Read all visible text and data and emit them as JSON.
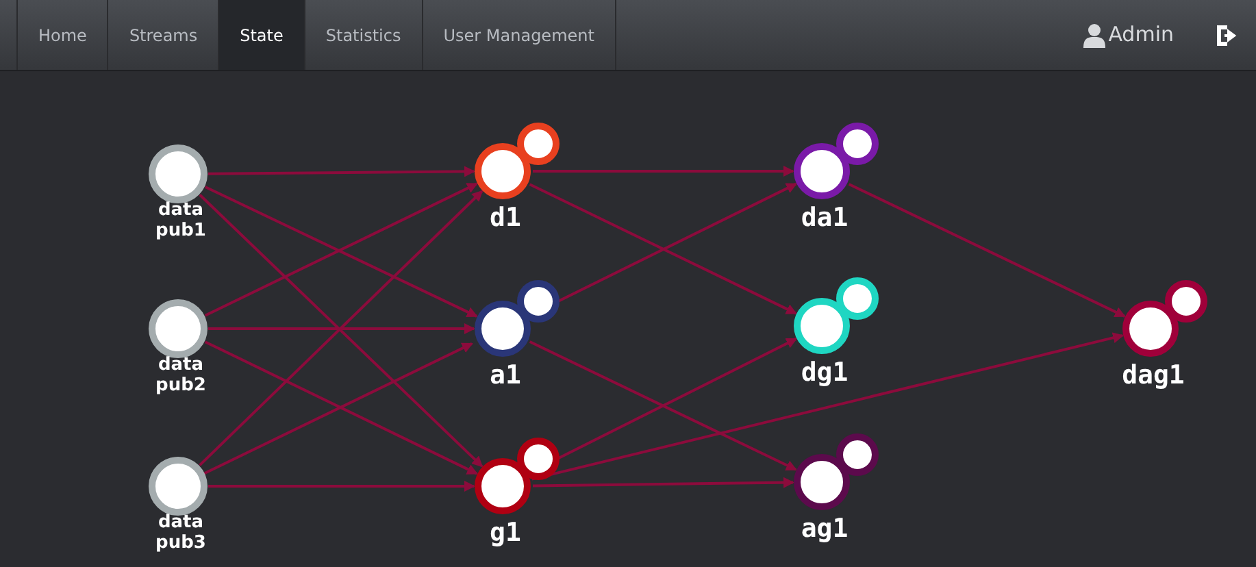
{
  "nav": {
    "tabs": [
      {
        "label": "Home",
        "selected": false
      },
      {
        "label": "Streams",
        "selected": false
      },
      {
        "label": "State",
        "selected": true
      },
      {
        "label": "Statistics",
        "selected": false
      },
      {
        "label": "User Management",
        "selected": false
      }
    ],
    "user": "Admin"
  },
  "graph": {
    "nodes": [
      {
        "label": "data pub1",
        "kind": "source"
      },
      {
        "label": "data pub2",
        "kind": "source"
      },
      {
        "label": "data pub3",
        "kind": "source"
      },
      {
        "label": "d1",
        "kind": "stage",
        "color": "#e8401f"
      },
      {
        "label": "a1",
        "kind": "stage",
        "color": "#2a3678"
      },
      {
        "label": "g1",
        "kind": "stage",
        "color": "#b00012"
      },
      {
        "label": "da1",
        "kind": "stage",
        "color": "#7a1aa8"
      },
      {
        "label": "dg1",
        "kind": "stage",
        "color": "#1fd6c2"
      },
      {
        "label": "ag1",
        "kind": "stage",
        "color": "#5c0a4c"
      },
      {
        "label": "dag1",
        "kind": "stage",
        "color": "#a0003a"
      }
    ]
  }
}
